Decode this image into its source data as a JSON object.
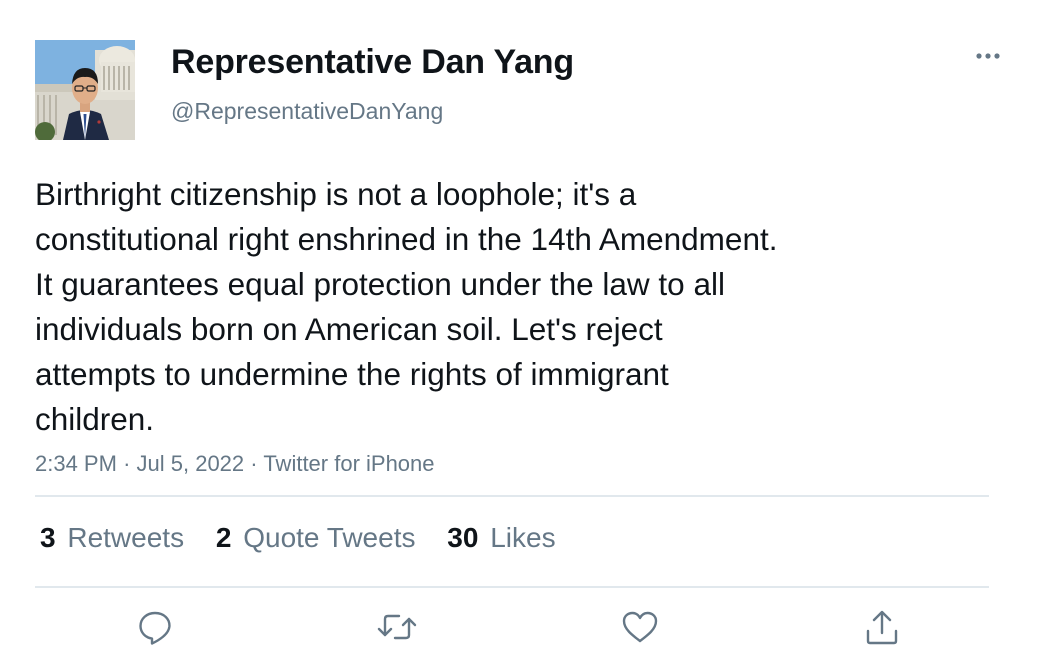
{
  "author": {
    "display_name": "Representative Dan Yang",
    "handle": "@RepresentativeDanYang",
    "avatar_icon": "profile-photo"
  },
  "menu": {
    "more_icon": "more-horizontal-icon"
  },
  "tweet": {
    "text": "Birthright citizenship is not a loophole; it's a\nconstitutional right enshrined in the 14th Amendment.\nIt guarantees equal protection under the law to all\nindividuals born on American soil. Let's reject\nattempts to undermine the rights of immigrant\nchildren.",
    "time": "2:34 PM",
    "separator": "·",
    "date": "Jul 5, 2022",
    "source": "Twitter for iPhone"
  },
  "stats": {
    "retweets": {
      "count": "3",
      "label": "Retweets"
    },
    "quote_tweets": {
      "count": "2",
      "label": "Quote Tweets"
    },
    "likes": {
      "count": "30",
      "label": "Likes"
    }
  },
  "actions": {
    "reply_icon": "reply-icon",
    "retweet_icon": "retweet-icon",
    "like_icon": "heart-icon",
    "share_icon": "share-icon"
  },
  "colors": {
    "text_primary": "#0f1419",
    "text_secondary": "#657786",
    "divider": "#e1e8ed",
    "icon": "#657786"
  }
}
